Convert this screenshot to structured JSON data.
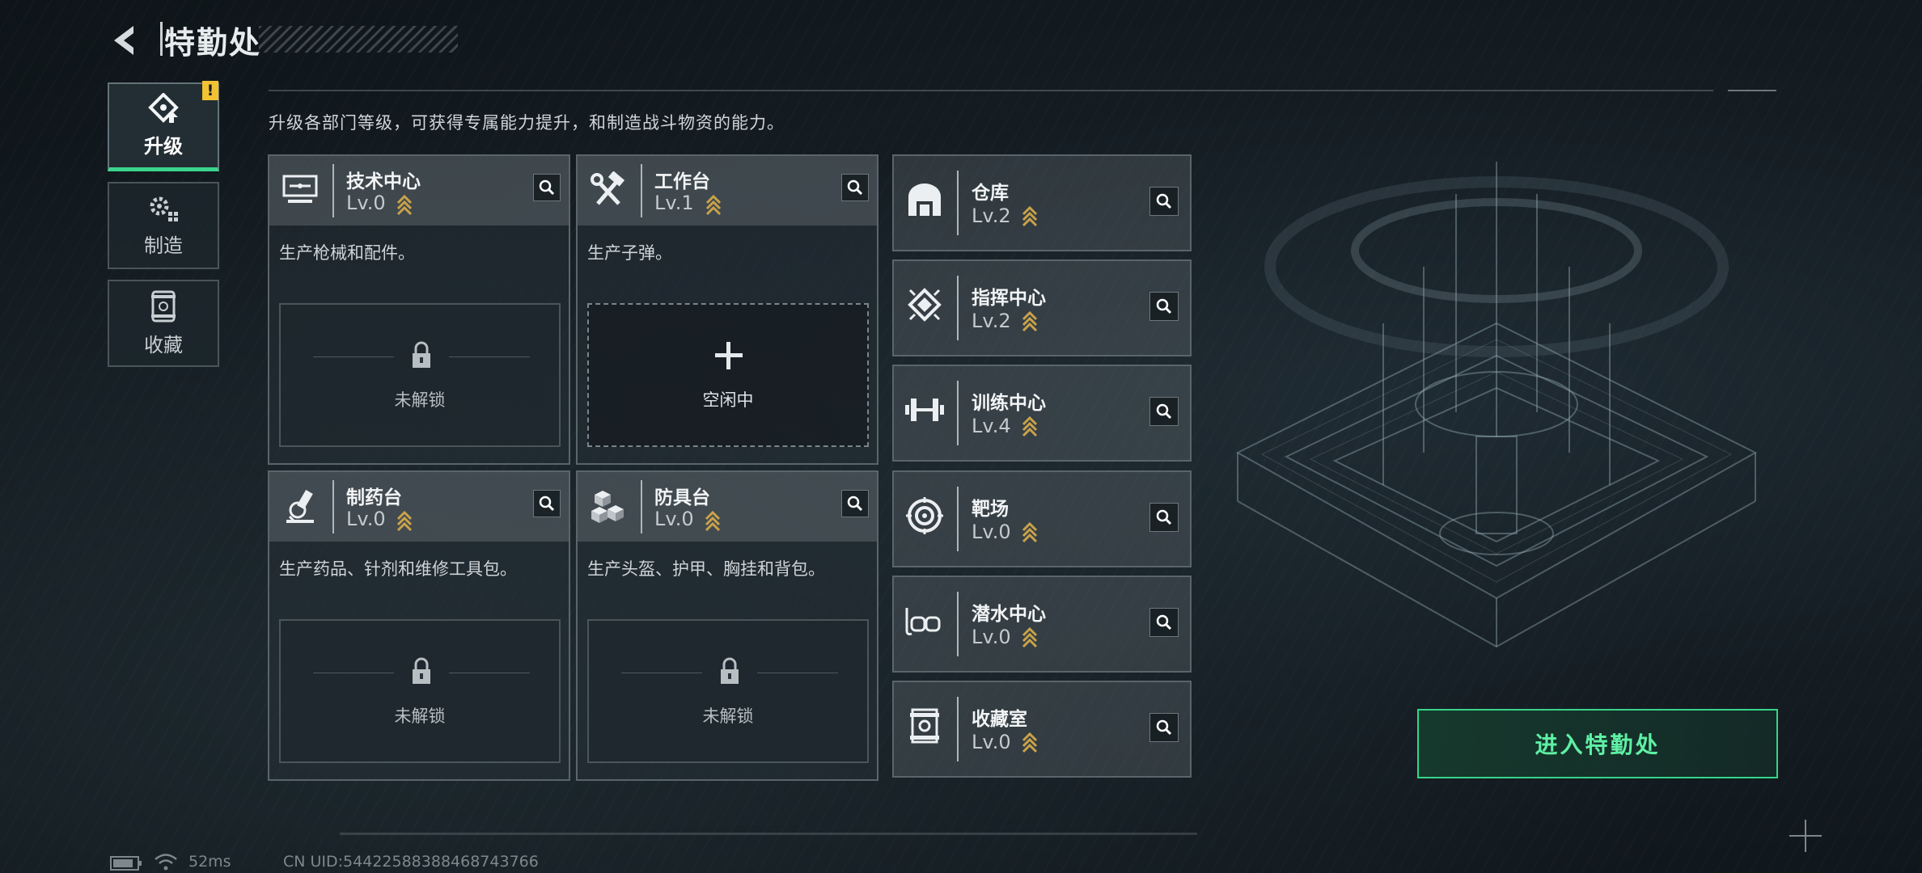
{
  "header": {
    "title": "特勤处"
  },
  "nav": [
    {
      "label": "升级",
      "icon": "upgrade-icon",
      "active": true,
      "alert": "!"
    },
    {
      "label": "制造",
      "icon": "gears-icon",
      "active": false
    },
    {
      "label": "收藏",
      "icon": "collection-icon",
      "active": false
    }
  ],
  "description": "升级各部门等级，可获得专属能力提升，和制造战斗物资的能力。",
  "departments": [
    {
      "name": "技术中心",
      "level": "Lv.0",
      "desc": "生产枪械和配件。",
      "slot": "未解锁",
      "icon": "tech-terminal-icon"
    },
    {
      "name": "工作台",
      "level": "Lv.1",
      "desc": "生产子弹。",
      "slot": "空闲中",
      "icon": "hammer-wrench-icon"
    },
    {
      "name": "制药台",
      "level": "Lv.0",
      "desc": "生产药品、针剂和维修工具包。",
      "slot": "未解锁",
      "icon": "microscope-icon"
    },
    {
      "name": "防具台",
      "level": "Lv.0",
      "desc": "生产头盔、护甲、胸挂和背包。",
      "slot": "未解锁",
      "icon": "boxes-icon"
    }
  ],
  "facilities": [
    {
      "name": "仓库",
      "level": "Lv.2",
      "icon": "warehouse-icon"
    },
    {
      "name": "指挥中心",
      "level": "Lv.2",
      "icon": "chip-icon"
    },
    {
      "name": "训练中心",
      "level": "Lv.4",
      "icon": "dumbbell-icon"
    },
    {
      "name": "靶场",
      "level": "Lv.0",
      "icon": "target-icon"
    },
    {
      "name": "潜水中心",
      "level": "Lv.0",
      "icon": "diving-mask-icon"
    },
    {
      "name": "收藏室",
      "level": "Lv.0",
      "icon": "vault-icon"
    }
  ],
  "enter_button": "进入特勤处",
  "status": {
    "ping": "52ms",
    "uid": "CN UID:5442258838846874376​6"
  },
  "colors": {
    "accent": "#3bd48c",
    "level_chevron": "#c9a24a",
    "alert": "#f1c232"
  }
}
